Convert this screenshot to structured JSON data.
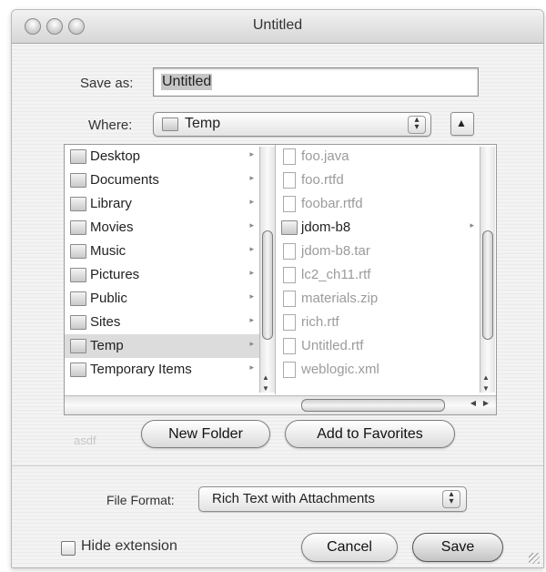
{
  "window": {
    "title": "Untitled"
  },
  "save_as": {
    "label": "Save as:",
    "value": "Untitled"
  },
  "where": {
    "label": "Where:",
    "value": "Temp",
    "collapse_glyph": "▲"
  },
  "left_column": [
    {
      "label": "Desktop",
      "icon": "desktop-icon",
      "arrow": "▸"
    },
    {
      "label": "Documents",
      "icon": "folder-icon",
      "arrow": "▸"
    },
    {
      "label": "Library",
      "icon": "folder-icon",
      "arrow": "▸"
    },
    {
      "label": "Movies",
      "icon": "folder-icon",
      "arrow": "▸"
    },
    {
      "label": "Music",
      "icon": "folder-icon",
      "arrow": "▸"
    },
    {
      "label": "Pictures",
      "icon": "folder-icon",
      "arrow": "▸"
    },
    {
      "label": "Public",
      "icon": "folder-icon",
      "arrow": "▸"
    },
    {
      "label": "Sites",
      "icon": "folder-icon",
      "arrow": "▸"
    },
    {
      "label": "Temp",
      "icon": "folder-icon",
      "arrow": "▸",
      "selected": true
    },
    {
      "label": "Temporary Items",
      "icon": "folder-icon",
      "arrow": "▸"
    }
  ],
  "right_column": [
    {
      "label": "foo.java",
      "icon": "file-icon",
      "dim": true
    },
    {
      "label": "foo.rtfd",
      "icon": "file-icon",
      "dim": true
    },
    {
      "label": "foobar.rtfd",
      "icon": "file-icon",
      "dim": true
    },
    {
      "label": "jdom-b8",
      "icon": "folder-icon",
      "arrow": "▸",
      "dim": false
    },
    {
      "label": "jdom-b8.tar",
      "icon": "file-icon",
      "dim": true
    },
    {
      "label": "lc2_ch11.rtf",
      "icon": "file-icon",
      "dim": true
    },
    {
      "label": "materials.zip",
      "icon": "file-icon",
      "dim": true
    },
    {
      "label": "rich.rtf",
      "icon": "file-icon",
      "dim": true
    },
    {
      "label": "Untitled.rtf",
      "icon": "file-icon",
      "dim": true
    },
    {
      "label": "weblogic.xml",
      "icon": "file-icon",
      "dim": true
    }
  ],
  "buttons": {
    "new_folder": "New Folder",
    "add_favorites": "Add to Favorites",
    "cancel": "Cancel",
    "save": "Save"
  },
  "background_text": "asdf",
  "file_format": {
    "label": "File Format:",
    "value": "Rich Text with Attachments"
  },
  "hide_extension": {
    "label": "Hide extension",
    "checked": false
  }
}
